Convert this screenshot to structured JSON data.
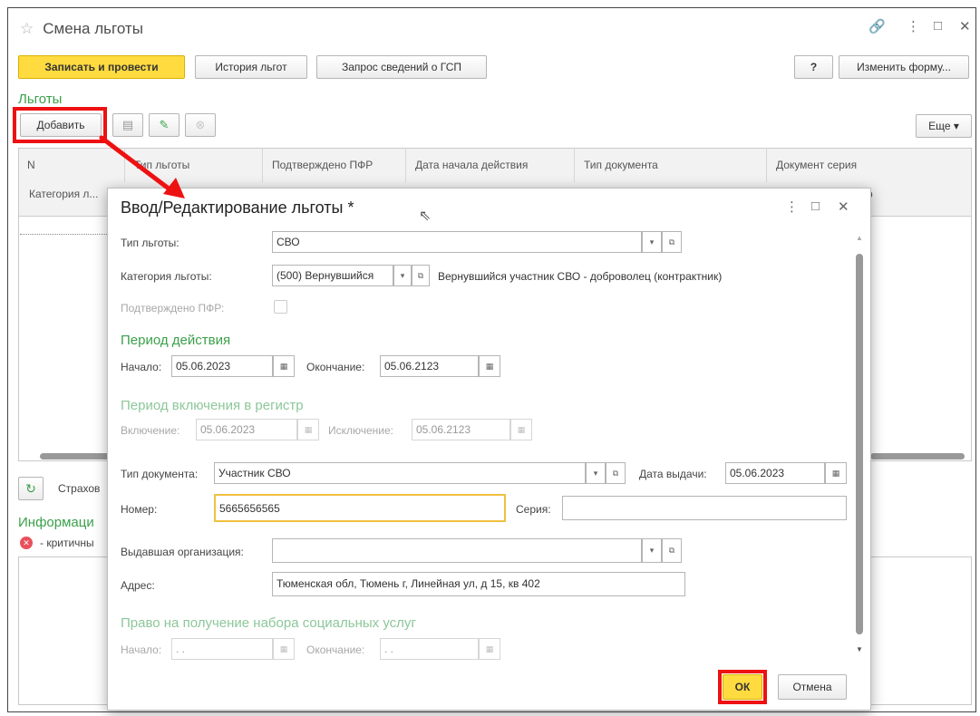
{
  "window": {
    "title": "Смена льготы",
    "controls": {
      "link": "🔗",
      "menu": "⋮",
      "maximize": "□",
      "close": "✕"
    }
  },
  "toolbar": {
    "save_post": "Записать и провести",
    "history": "История льгот",
    "gsp_request": "Запрос сведений о ГСП",
    "help": "?",
    "change_form": "Изменить форму..."
  },
  "benefits": {
    "section_title": "Льготы",
    "add": "Добавить",
    "more": "Еще ▾",
    "columns": [
      "N",
      "Тип льготы",
      "Подтверждено ПФР",
      "Дата начала действия",
      "Тип документа",
      "Документ серия"
    ],
    "row2": {
      "first": "Категория л...",
      "last": "р"
    }
  },
  "lower": {
    "insurance_label": "Страхов",
    "info_title": "Информаци",
    "critical_label": "- критичны"
  },
  "dialog": {
    "title": "Ввод/Редактирование льготы *",
    "benefit_type_label": "Тип льготы:",
    "benefit_type_value": "СВО",
    "category_label": "Категория льготы:",
    "category_value": "(500) Вернувшийся",
    "category_desc": "Вернувшийся участник СВО - доброволец (контрактник)",
    "pfr_label": "Подтверждено ПФР:",
    "period_title": "Период действия",
    "start_label": "Начало:",
    "start_value": "05.06.2023",
    "end_label": "Окончание:",
    "end_value": "05.06.2123",
    "register_title": "Период включения в регистр",
    "include_label": "Включение:",
    "include_value": "05.06.2023",
    "exclude_label": "Исключение:",
    "exclude_value": "05.06.2123",
    "doc_type_label": "Тип документа:",
    "doc_type_value": "Участник СВО",
    "issue_date_label": "Дата выдачи:",
    "issue_date_value": "05.06.2023",
    "number_label": "Номер:",
    "number_value": "5665656565",
    "series_label": "Серия:",
    "series_value": "",
    "org_label": "Выдавшая организация:",
    "org_value": "",
    "address_label": "Адрес:",
    "address_value": "Тюменская обл, Тюмень г, Линейная ул, д 15, кв 402",
    "social_title": "Право на получение набора социальных услуг",
    "social_start_label": "Начало:",
    "social_start_value": " .  .",
    "social_end_label": "Окончание:",
    "social_end_value": " .  .",
    "ok": "ОК",
    "cancel": "Отмена",
    "controls": {
      "menu": "⋮",
      "maximize": "□",
      "close": "✕"
    }
  },
  "colors": {
    "highlight": "#ee1111",
    "primary_button": "#ffdb40",
    "section_green": "#3aa04a",
    "focus_border": "#f0c040"
  }
}
